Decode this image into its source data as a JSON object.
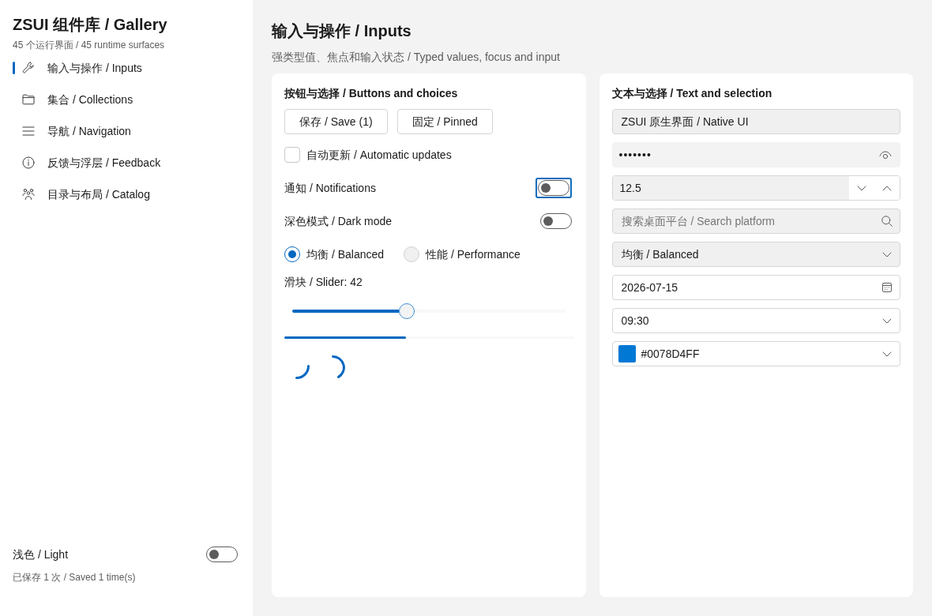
{
  "sidebar": {
    "title": "ZSUI 组件库 / Gallery",
    "subtitle": "45 个运行界面 / 45 runtime surfaces",
    "items": [
      {
        "label": "输入与操作 / Inputs",
        "selected": true
      },
      {
        "label": "集合 / Collections",
        "selected": false
      },
      {
        "label": "导航 / Navigation",
        "selected": false
      },
      {
        "label": "反馈与浮层 / Feedback",
        "selected": false
      },
      {
        "label": "目录与布局 / Catalog",
        "selected": false
      }
    ],
    "theme_toggle": {
      "label": "浅色 / Light",
      "on": false
    },
    "status": "已保存 1 次 / Saved 1 time(s)"
  },
  "page": {
    "title": "输入与操作 / Inputs",
    "subtitle": "强类型值、焦点和输入状态 / Typed values, focus and input"
  },
  "buttons_card": {
    "title": "按钮与选择 / Buttons and choices",
    "buttons": [
      "保存 / Save (1)",
      "固定 / Pinned"
    ],
    "checkbox": {
      "label": "自动更新 / Automatic updates",
      "checked": false
    },
    "toggles": [
      {
        "label": "通知 / Notifications",
        "on": false,
        "focused": true
      },
      {
        "label": "深色模式 / Dark mode",
        "on": false,
        "focused": false
      }
    ],
    "radios": [
      {
        "label": "均衡 / Balanced",
        "selected": true
      },
      {
        "label": "性能 / Performance",
        "selected": false
      }
    ],
    "slider": {
      "label": "滑块 / Slider: 42",
      "level": 0.42
    },
    "progress": {
      "level": 0.42
    }
  },
  "text_card": {
    "title": "文本与选择 / Text and selection",
    "fields": [
      {
        "kind": "text",
        "value": "ZSUI 原生界面 / Native UI"
      },
      {
        "kind": "password",
        "value": "•••••••"
      },
      {
        "kind": "number",
        "value": "12.5"
      },
      {
        "kind": "search",
        "placeholder": "搜索桌面平台 / Search platform"
      },
      {
        "kind": "select",
        "value": "均衡 / Balanced"
      },
      {
        "kind": "date",
        "value": "2026-07-15"
      },
      {
        "kind": "time",
        "value": "09:30"
      },
      {
        "kind": "color",
        "value": "#0078D4FF",
        "color": "#0078d4"
      }
    ]
  }
}
